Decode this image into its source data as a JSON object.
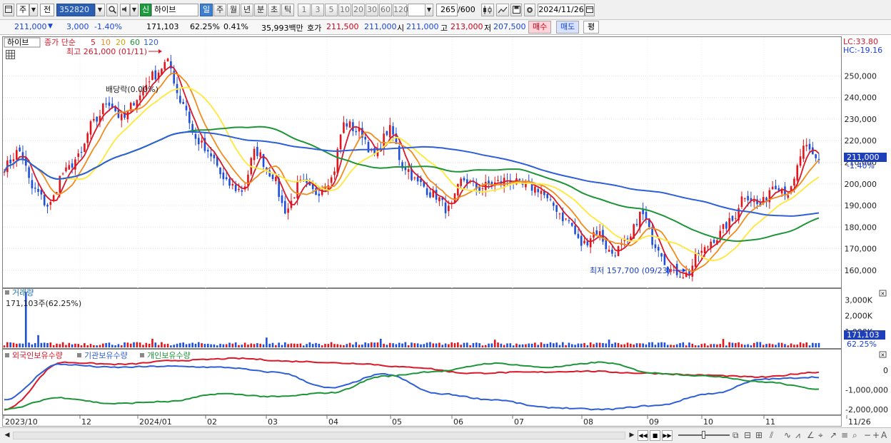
{
  "toolbar": {
    "type_label": "주",
    "prev_label": "전",
    "code": "352820",
    "name_prefix": "신",
    "name": "하이브",
    "periods": [
      "일",
      "주",
      "월",
      "년",
      "분",
      "초",
      "틱"
    ],
    "intervals": [
      "1",
      "3",
      "5",
      "10",
      "20",
      "30",
      "60",
      "120"
    ],
    "count": "265",
    "count_total": "/600",
    "date": "2024/11/26"
  },
  "info": {
    "price": "211,000",
    "change": "3,000",
    "rate": "-1.40%",
    "volume": "171,103",
    "vol_ratio": "62.25%",
    "turnover": "0.41%",
    "amount": "35,993백만",
    "ask_label": "호가",
    "ask1": "211,500",
    "ask2": "211,000",
    "open_label": "시",
    "open": "211,000",
    "high_label": "고",
    "high": "213,000",
    "low_label": "저",
    "low": "207,500",
    "buy": "매수",
    "sell": "매도",
    "eval": "평"
  },
  "price_panel": {
    "name": "하이브",
    "legend_title": "종가 단순",
    "ma_labels": [
      "5",
      "10",
      "20",
      "60",
      "120"
    ],
    "ma_colors": [
      "#d9192a",
      "#f08c1e",
      "#ffe94a",
      "#1d9438",
      "#2f5fd6"
    ],
    "lc": "LC:33.80",
    "hc": "HC:-19.16",
    "high_note": "최고 261,000 (01/11)",
    "low_note": "최저 157,700 (09/23)",
    "ex_div": "배당락(0.00%)",
    "y_ticks": [
      "250,000",
      "240,000",
      "230,000",
      "220,000",
      "210,000",
      "200,000",
      "190,000",
      "180,000",
      "170,000",
      "160,000"
    ],
    "tag_price": "211,000",
    "tag_change": "-1.40%"
  },
  "volume_panel": {
    "title": "거래량",
    "value": "171,103주(62.25%)",
    "y_ticks": [
      "3,000K",
      "2,000K",
      "1,000K"
    ],
    "tag_value": "171,103",
    "tag_ratio": "62.25%"
  },
  "holding_panel": {
    "labels": [
      "외국인보유수량",
      "기관보유수량",
      "개인보유수량"
    ],
    "colors": [
      "#d9192a",
      "#2f5fd6",
      "#1d9438"
    ],
    "y_ticks": [
      "0",
      "-1,000,000",
      "-2,000,000"
    ]
  },
  "x_axis": [
    "2023/10",
    "12",
    "2024/01",
    "02",
    "03",
    "04",
    "05",
    "06",
    "07",
    "08",
    "09",
    "10",
    "11",
    "11/26"
  ],
  "chart_data": {
    "type": "candlestick",
    "price_range": [
      152000,
      268000
    ],
    "anchors": [
      [
        "2023/10",
        208000
      ],
      [
        "2023/10",
        215000
      ],
      [
        "2023/10",
        197000
      ],
      [
        "2023/11",
        190000
      ],
      [
        "2023/11",
        205000
      ],
      [
        "2023/11",
        212000
      ],
      [
        "2023/12",
        228000
      ],
      [
        "2023/12",
        238000
      ],
      [
        "2023/12",
        230000
      ],
      [
        "2024/01",
        240000
      ],
      [
        "2024/01",
        250000
      ],
      [
        "2024/01",
        256000
      ],
      [
        "2024/01",
        238000
      ],
      [
        "2024/01",
        220000
      ],
      [
        "2024/02",
        212000
      ],
      [
        "2024/02",
        200000
      ],
      [
        "2024/02",
        197000
      ],
      [
        "2024/02",
        215000
      ],
      [
        "2024/03",
        205000
      ],
      [
        "2024/03",
        188000
      ],
      [
        "2024/03",
        200000
      ],
      [
        "2024/03",
        196000
      ],
      [
        "2024/04",
        202000
      ],
      [
        "2024/04",
        228000
      ],
      [
        "2024/04",
        224000
      ],
      [
        "2024/04",
        213000
      ],
      [
        "2024/04",
        225000
      ],
      [
        "2024/05",
        208000
      ],
      [
        "2024/05",
        200000
      ],
      [
        "2024/05",
        195000
      ],
      [
        "2024/05",
        188000
      ],
      [
        "2024/06",
        202000
      ],
      [
        "2024/06",
        198000
      ],
      [
        "2024/06",
        200000
      ],
      [
        "2024/06",
        202000
      ],
      [
        "2024/07",
        199000
      ],
      [
        "2024/07",
        198000
      ],
      [
        "2024/07",
        190000
      ],
      [
        "2024/07",
        183000
      ],
      [
        "2024/08",
        172000
      ],
      [
        "2024/08",
        178000
      ],
      [
        "2024/08",
        168000
      ],
      [
        "2024/08",
        172000
      ],
      [
        "2024/09",
        186000
      ],
      [
        "2024/09",
        172000
      ],
      [
        "2024/09",
        160000
      ],
      [
        "2024/09",
        158000
      ],
      [
        "2024/10",
        168000
      ],
      [
        "2024/10",
        175000
      ],
      [
        "2024/10",
        182000
      ],
      [
        "2024/10",
        195000
      ],
      [
        "2024/11",
        190000
      ],
      [
        "2024/11",
        200000
      ],
      [
        "2024/11",
        196000
      ],
      [
        "2024/11",
        216000
      ],
      [
        "2024/11/26",
        211000
      ]
    ]
  }
}
